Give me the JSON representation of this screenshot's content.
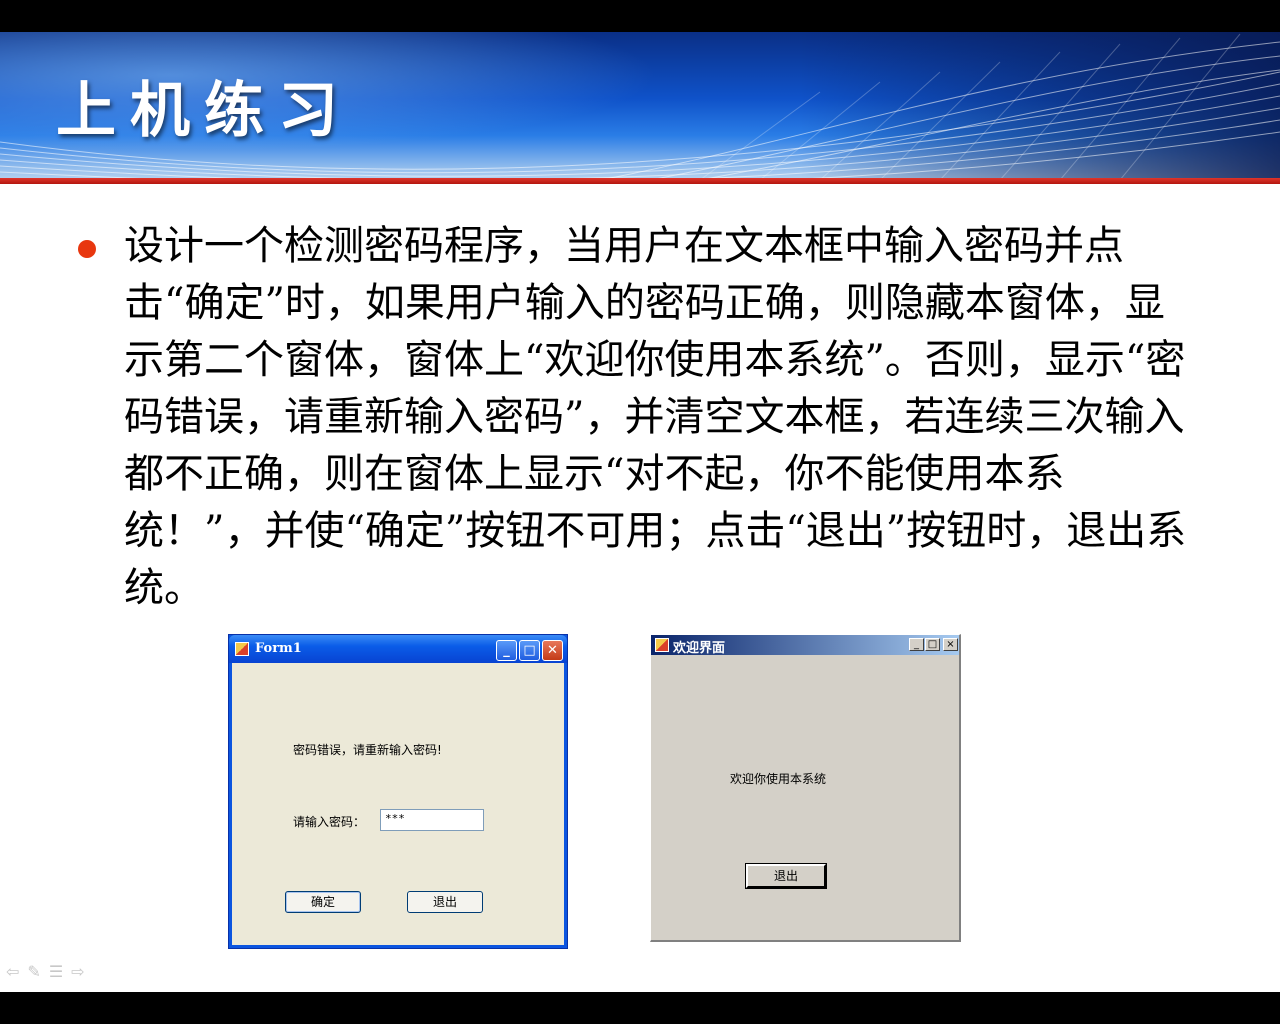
{
  "slide": {
    "title": "上机练习",
    "body": "设计一个检测密码程序，当用户在文本框中输入密码并点击“确定”时，如果用户输入的密码正确，则隐藏本窗体，显示第二个窗体，窗体上“欢迎你使用本系统”。否则，显示“密码错误，请重新输入密码”，并清空文本框，若连续三次输入都不正确，则在窗体上显示“对不起，你不能使用本系统！”，并使“确定”按钮不可用；点击“退出”按钮时，退出系统。"
  },
  "form1": {
    "title": "Form1",
    "error_message": "密码错误，请重新输入密码!",
    "prompt_label": "请输入密码：",
    "password_value": "***",
    "ok_label": "确定",
    "exit_label": "退出",
    "controls": {
      "minimize": "_",
      "maximize": "□",
      "close": "✕"
    }
  },
  "welcome": {
    "title": "欢迎界面",
    "message": "欢迎你使用本系统",
    "exit_label": "退出",
    "controls": {
      "minimize": "_",
      "maximize": "□",
      "close": "×"
    }
  },
  "nav_icons": [
    "arrow-left-icon",
    "pen-icon",
    "menu-icon",
    "arrow-right-icon"
  ],
  "colors": {
    "accent_red": "#e8370f",
    "banner_blue": "#0f52c9"
  }
}
